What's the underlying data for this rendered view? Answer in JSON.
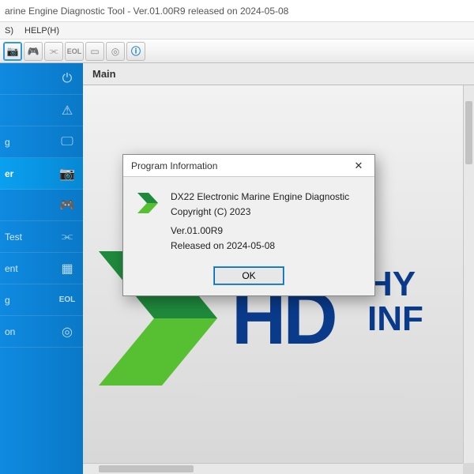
{
  "window": {
    "title": "arine Engine Diagnostic Tool - Ver.01.00R9 released on 2024-05-08"
  },
  "menu": {
    "items": [
      "S)",
      "HELP(H)"
    ]
  },
  "toolbar": {
    "icons": [
      "camera",
      "controller",
      "nodes",
      "eol",
      "blank",
      "eol2",
      "info"
    ]
  },
  "sidebar": {
    "items": [
      {
        "label": "",
        "icon": "power",
        "active": false
      },
      {
        "label": "",
        "icon": "warning",
        "active": false
      },
      {
        "label": "g",
        "icon": "monitor",
        "active": false
      },
      {
        "label": "er",
        "icon": "camera",
        "active": true
      },
      {
        "label": "",
        "icon": "controller",
        "active": false
      },
      {
        "label": "Test",
        "icon": "nodes",
        "active": false
      },
      {
        "label": "ent",
        "icon": "box",
        "active": false
      },
      {
        "label": "g",
        "icon": "eol",
        "active": false
      },
      {
        "label": "on",
        "icon": "eol2",
        "active": false
      }
    ]
  },
  "main": {
    "header": "Main",
    "logo_primary": "HD",
    "logo_secondary_line1": "HY",
    "logo_secondary_line2": "INF"
  },
  "dialog": {
    "title": "Program Information",
    "product": "DX22 Electronic Marine Engine Diagnostic",
    "copyright": "Copyright (C) 2023",
    "version": "Ver.01.00R9",
    "released": "Released on 2024-05-08",
    "ok_label": "OK",
    "close_glyph": "✕"
  },
  "colors": {
    "brand_blue": "#0a3a8a",
    "sidebar_blue": "#0a78c7",
    "accent": "#2e9bd6",
    "chevron_green_dark": "#1f8a3d",
    "chevron_green_light": "#56c032"
  }
}
